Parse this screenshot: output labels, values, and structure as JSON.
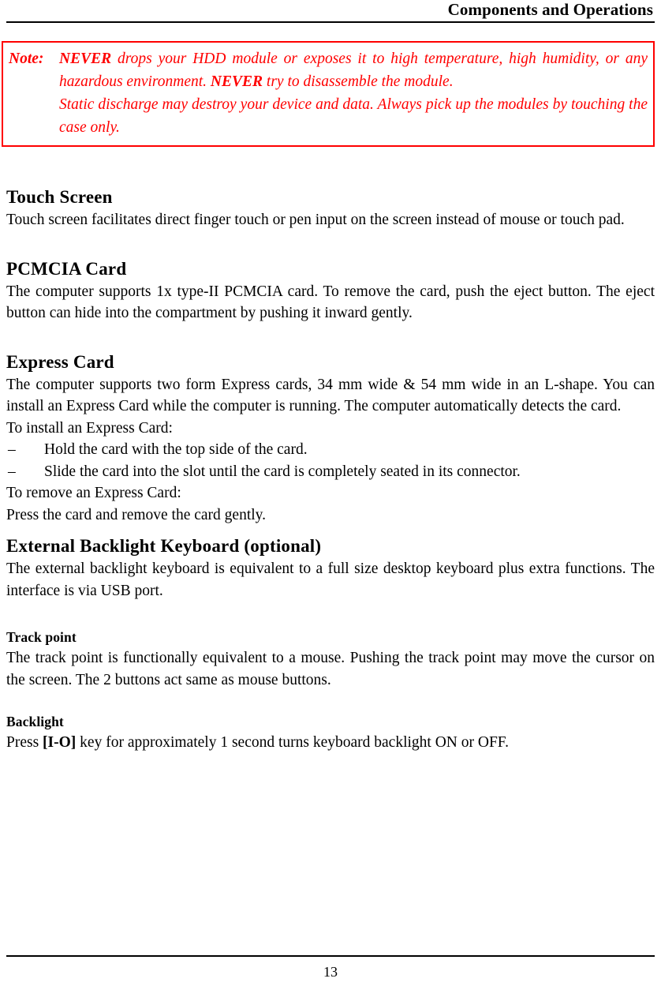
{
  "header": {
    "title": "Components and Operations"
  },
  "note": {
    "label": "Note:",
    "emphasis_1": "NEVER",
    "line_1_rest": " drops your HDD module or exposes it to high temperature, high humidity, or any hazardous environment. ",
    "emphasis_2": "NEVER",
    "line_1_tail": " try to disassemble the module.",
    "paragraph_2": "Static discharge may destroy your device and data. Always pick up the modules by touching the case only.",
    "border_color": "#FF0000",
    "text_color": "#FF0000"
  },
  "sections": {
    "touch_screen": {
      "heading": "Touch Screen",
      "body": "Touch screen facilitates direct finger touch or pen input on the screen instead of mouse or touch pad."
    },
    "pcmcia_card": {
      "heading": "PCMCIA Card",
      "body": "The computer supports 1x type-II PCMCIA card. To remove the card, push the eject button. The eject button can hide into the compartment by pushing it inward gently."
    },
    "express_card": {
      "heading": "Express Card",
      "body": "The computer supports two form Express cards, 34 mm wide & 54 mm wide in an L-shape. You can install an Express Card while the computer is running. The computer automatically detects the card.",
      "install_intro": "To install an Express Card:",
      "install_steps": [
        {
          "marker": "–",
          "text": "Hold the card with the top side of the card."
        },
        {
          "marker": "–",
          "text": "Slide the card into the slot until the card is completely seated in its connector."
        }
      ],
      "remove_intro": "To remove an Express Card:",
      "remove_body": "Press the card and remove the card gently."
    },
    "external_backlight_keyboard": {
      "heading": "External Backlight Keyboard (optional)",
      "body": "The external backlight keyboard is equivalent to a full size desktop keyboard plus extra functions. The interface is via USB port."
    },
    "track_point": {
      "heading": "Track point",
      "body": "The track point is functionally equivalent to a mouse. Pushing the track point may move the cursor on the screen. The 2 buttons act same as mouse buttons."
    },
    "backlight": {
      "heading": "Backlight",
      "body_prefix": "Press ",
      "key_label": "[I-O]",
      "body_suffix": " key for approximately 1 second turns keyboard backlight ON or OFF."
    }
  },
  "footer": {
    "page_number": "13"
  }
}
